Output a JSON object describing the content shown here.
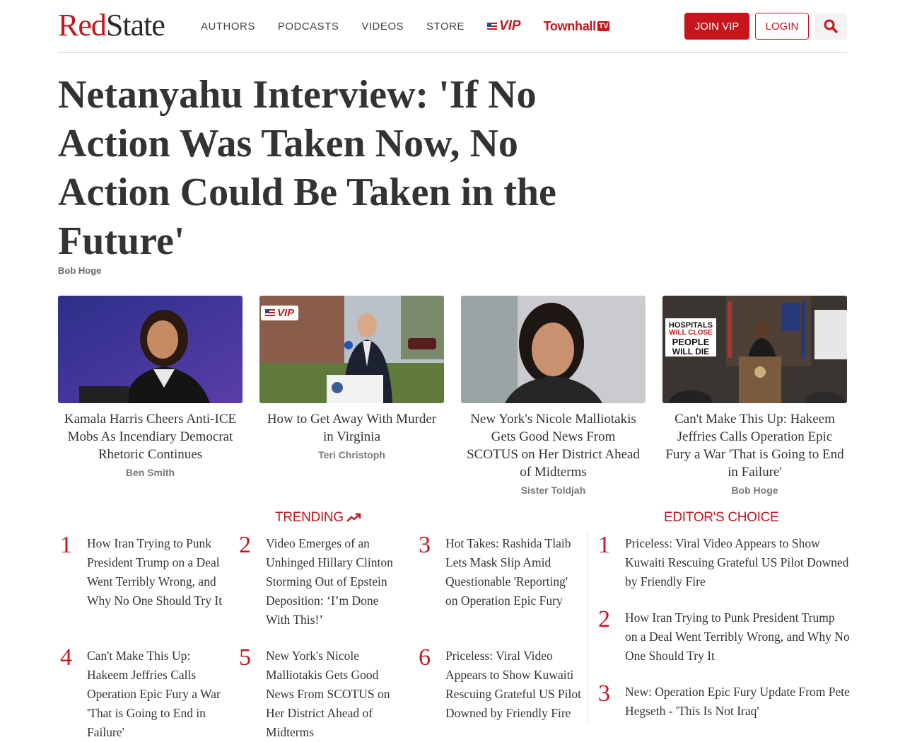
{
  "header": {
    "logo_red": "Red",
    "logo_dark": "State",
    "nav": [
      "AUTHORS",
      "PODCASTS",
      "VIDEOS",
      "STORE"
    ],
    "vip_label": "VIP",
    "townhall_label": "Townhall",
    "townhall_tv": "TV",
    "join_label": "JOIN VIP",
    "login_label": "LOGIN",
    "accent_color": "#c4161c"
  },
  "article": {
    "headline": "Netanyahu Interview: 'If No Action Was Taken Now, No Action Could Be Taken in the Future'",
    "author": "Bob Hoge"
  },
  "cards": [
    {
      "title": "Kamala Harris Cheers Anti-ICE Mobs As Incendiary Democrat Rhetoric Continues",
      "author": "Ben Smith",
      "vip": false
    },
    {
      "title": "How to Get Away With Murder in Virginia",
      "author": "Teri Christoph",
      "vip": true,
      "vip_label": "VIP"
    },
    {
      "title": "New York's Nicole Malliotakis Gets Good News From SCOTUS on Her District Ahead of Midterms",
      "author": "Sister Toldjah",
      "vip": false
    },
    {
      "title": "Can't Make This Up: Hakeem Jeffries Calls Operation Epic Fury a War 'That is Going to End in Failure'",
      "author": "Bob Hoge",
      "vip": false,
      "sign_text": [
        "HOSPITALS",
        "WILL CLOSE",
        "PEOPLE",
        "WILL DIE"
      ]
    }
  ],
  "trending": {
    "label": "TRENDING",
    "items": [
      {
        "num": "1",
        "title": "How Iran Trying to Punk President Trump on a Deal Went Terribly Wrong, and Why No One Should Try It"
      },
      {
        "num": "2",
        "title": "Video Emerges of an Unhinged Hillary Clinton Storming Out of Epstein Deposition: ‘I’m Done With This!’"
      },
      {
        "num": "3",
        "title": "Hot Takes: Rashida Tlaib Lets Mask Slip Amid Questionable 'Reporting' on Operation Epic Fury"
      },
      {
        "num": "4",
        "title": "Can't Make This Up: Hakeem Jeffries Calls Operation Epic Fury a War 'That is Going to End in Failure'"
      },
      {
        "num": "5",
        "title": "New York's Nicole Malliotakis Gets Good News From SCOTUS on Her District Ahead of Midterms"
      },
      {
        "num": "6",
        "title": "Priceless: Viral Video Appears to Show Kuwaiti Rescuing Grateful US Pilot Downed by Friendly Fire"
      }
    ]
  },
  "editors_choice": {
    "label": "EDITOR'S CHOICE",
    "items": [
      {
        "num": "1",
        "title": "Priceless: Viral Video Appears to Show Kuwaiti Rescuing Grateful US Pilot Downed by Friendly Fire"
      },
      {
        "num": "2",
        "title": "How Iran Trying to Punk President Trump on a Deal Went Terribly Wrong, and Why No One Should Try It"
      },
      {
        "num": "3",
        "title": "New: Operation Epic Fury Update From Pete Hegseth - 'This Is Not Iraq'"
      }
    ]
  }
}
